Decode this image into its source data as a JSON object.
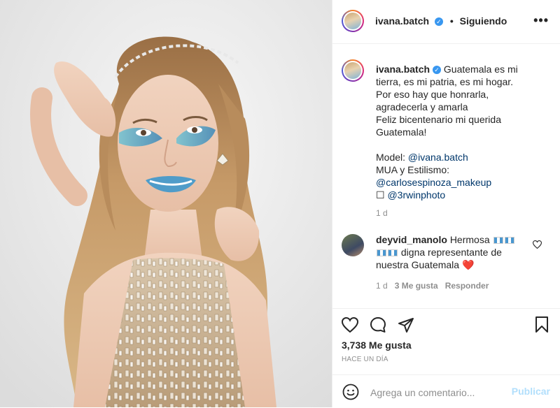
{
  "post": {
    "author": "ivana.batch",
    "follow_state": "Siguiendo",
    "separator": "•",
    "more_label": "•••",
    "caption": {
      "author": "ivana.batch",
      "lines": [
        "Guatemala es mi",
        "tierra, es mi patria, es mi hogar.",
        "Por eso hay que honrarla,",
        "agradecerla y amarla",
        "Feliz bicentenario mi querida",
        "Guatemala!"
      ],
      "model_prefix": "Model: ",
      "model_link": "@ivana.batch",
      "mua_prefix": "MUA y Estilismo:",
      "mua_link": "@carlosespinoza_makeup",
      "photo_prefix": "☐ ",
      "photo_link": "@3rwinphoto",
      "age": "1 d"
    },
    "comment": {
      "author": "deyvid_manolo",
      "text_start": "Hermosa",
      "text_mid": "digna representante de",
      "text_end": "nuestra Guatemala",
      "heart": "❤️",
      "age": "1 d",
      "likes": "3 Me gusta",
      "reply": "Responder"
    },
    "likes": "3,738 Me gusta",
    "timestamp": "HACE UN DÍA",
    "add_comment": {
      "placeholder": "Agrega un comentario...",
      "publish": "Publicar"
    }
  },
  "colors": {
    "link": "#00376b",
    "verified": "#3897f0",
    "publish_disabled": "#b2dffc",
    "muted": "#8e8e8e"
  }
}
